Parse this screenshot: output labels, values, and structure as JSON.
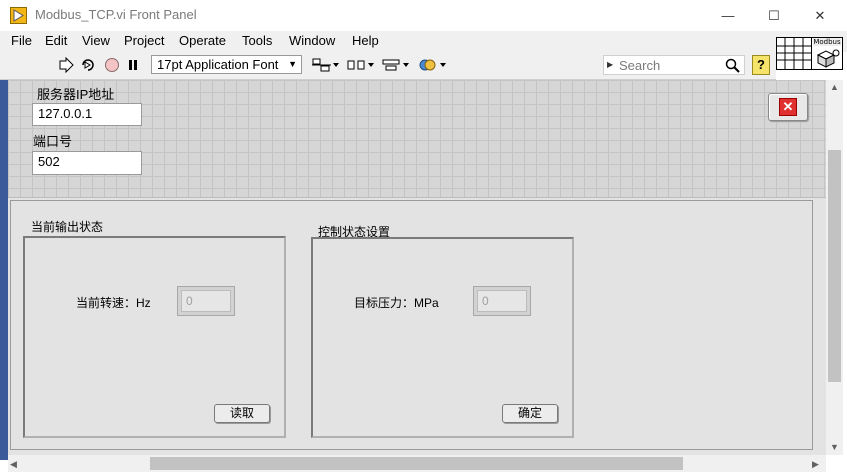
{
  "window": {
    "title": "Modbus_TCP.vi Front Panel",
    "minimize": "—",
    "maximize": "☐",
    "close": "✕"
  },
  "menu": [
    "File",
    "Edit",
    "View",
    "Project",
    "Operate",
    "Tools",
    "Window",
    "Help"
  ],
  "toolbar": {
    "run_icon": "run-arrow-icon",
    "run_continuous_icon": "run-continuously-icon",
    "abort_icon": "abort-icon",
    "pause_icon": "pause-icon",
    "font": "17pt Application Font",
    "align_icon": "align-objects-icon",
    "distribute_icon": "distribute-objects-icon",
    "resize_icon": "resize-objects-icon",
    "reorder_icon": "reorder-icon",
    "search_placeholder": "Search",
    "help": "?"
  },
  "vi_icon_text": "Modbus",
  "controls": {
    "ip_label": "服务器IP地址",
    "ip_value": "127.0.0.1",
    "port_label": "端口号",
    "port_value": "502"
  },
  "groups": {
    "output": {
      "title": "当前输出状态",
      "indicator_label": "当前转速：Hz",
      "indicator_value": "0",
      "button": "读取"
    },
    "control": {
      "title": "控制状态设置",
      "control_label": "目标压力：MPa",
      "control_value": "0",
      "button": "确定"
    }
  },
  "colors": {
    "stop_button": "#e03030",
    "vi_icon_bg": "#f3b616"
  }
}
